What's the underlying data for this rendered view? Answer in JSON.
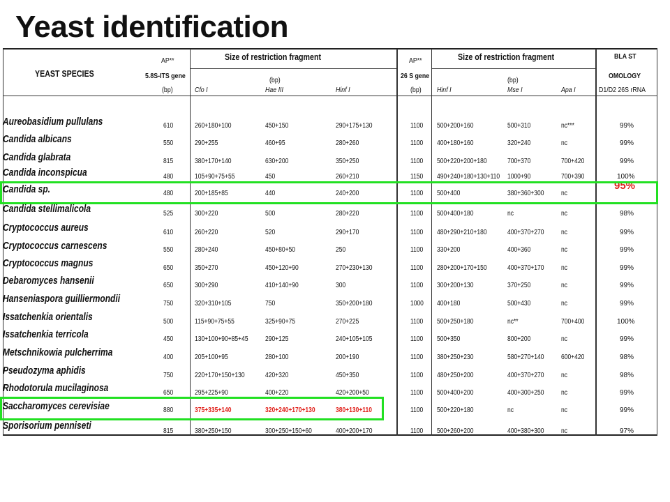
{
  "title": "Yeast identification",
  "header": {
    "species_label": "YEAST SPECIES",
    "ap1_label": "AP**",
    "ap1_gene": "5.8S-ITS gene",
    "ap1_unit": "(bp)",
    "frag1_label": "Size of restriction fragment",
    "frag1_unit": "(bp)",
    "enz1": [
      "Cfo I",
      "Hae III",
      "Hinf I"
    ],
    "ap2_label": "AP**",
    "ap2_gene": "26 S gene",
    "ap2_unit": "(bp)",
    "frag2_label": "Size of restriction fragment",
    "frag2_unit": "(bp)",
    "enz2": [
      "Hinf I",
      "Mse I",
      "Apa I"
    ],
    "blast_label": "BLA ST",
    "homology_label": "OMOLOGY",
    "homology_sub": "D1/D2 26S rRNA"
  },
  "rows": [
    {
      "species": "Aureobasidium pullulans",
      "ap1": "610",
      "cfo": "260+180+100",
      "hae": "450+150",
      "hinf1": "290+175+130",
      "ap2": "1100",
      "hinf2": "500+200+160",
      "mse": "500+310",
      "apa": "nc***",
      "hom": "99%"
    },
    {
      "species": "Candida albicans",
      "ap1": "550",
      "cfo": "290+255",
      "hae": "460+95",
      "hinf1": "280+260",
      "ap2": "1100",
      "hinf2": "400+180+160",
      "mse": "320+240",
      "apa": "nc",
      "hom": "99%"
    },
    {
      "species": "Candida glabrata",
      "ap1": "815",
      "cfo": "380+170+140",
      "hae": "630+200",
      "hinf1": "350+250",
      "ap2": "1100",
      "hinf2": "500+220+200+180",
      "mse": "700+370",
      "apa": "700+420",
      "hom": "99%"
    },
    {
      "species": "Candida inconspicua",
      "ap1": "480",
      "cfo": "105+90+75+55",
      "hae": "450",
      "hinf1": "260+210",
      "ap2": "1150",
      "hinf2": "490+240+180+130+110",
      "mse": "1000+90",
      "apa": "700+390",
      "hom": "100%"
    },
    {
      "species": "Candida sp.",
      "ap1": "480",
      "cfo": "200+185+85",
      "hae": "440",
      "hinf1": "240+200",
      "ap2": "1100",
      "hinf2": "500+400",
      "mse": "380+360+300",
      "apa": "nc",
      "hom": "95%"
    },
    {
      "species": "Candida stellimalicola",
      "ap1": "525",
      "cfo": "300+220",
      "hae": "500",
      "hinf1": "280+220",
      "ap2": "1100",
      "hinf2": "500+400+180",
      "mse": "nc",
      "apa": "nc",
      "hom": "98%"
    },
    {
      "species": "Cryptococcus aureus",
      "ap1": "610",
      "cfo": "260+220",
      "hae": "520",
      "hinf1": "290+170",
      "ap2": "1100",
      "hinf2": "480+290+210+180",
      "mse": "400+370+270",
      "apa": "nc",
      "hom": "99%"
    },
    {
      "species": "Cryptococcus carnescens",
      "ap1": "550",
      "cfo": "280+240",
      "hae": "450+80+50",
      "hinf1": "250",
      "ap2": "1100",
      "hinf2": "330+200",
      "mse": "400+360",
      "apa": "nc",
      "hom": "99%"
    },
    {
      "species": "Cryptococcus magnus",
      "ap1": "650",
      "cfo": "350+270",
      "hae": "450+120+90",
      "hinf1": "270+230+130",
      "ap2": "1100",
      "hinf2": "280+200+170+150",
      "mse": "400+370+170",
      "apa": "nc",
      "hom": "99%"
    },
    {
      "species": "Debaromyces hansenii",
      "ap1": "650",
      "cfo": "300+290",
      "hae": "410+140+90",
      "hinf1": "300",
      "ap2": "1100",
      "hinf2": "300+200+130",
      "mse": "370+250",
      "apa": "nc",
      "hom": "99%"
    },
    {
      "species": "Hanseniaspora guilliermondii",
      "ap1": "750",
      "cfo": "320+310+105",
      "hae": "750",
      "hinf1": "350+200+180",
      "ap2": "1000",
      "hinf2": "400+180",
      "mse": "500+430",
      "apa": "nc",
      "hom": "99%"
    },
    {
      "species": "Issatchenkia orientalis",
      "ap1": "500",
      "cfo": "115+90+75+55",
      "hae": "325+90+75",
      "hinf1": "270+225",
      "ap2": "1100",
      "hinf2": "500+250+180",
      "mse": "nc**",
      "apa": "700+400",
      "hom": "100%"
    },
    {
      "species": "Issatchenkia terricola",
      "ap1": "450",
      "cfo": "130+100+90+85+45",
      "hae": "290+125",
      "hinf1": "240+105+105",
      "ap2": "1100",
      "hinf2": "500+350",
      "mse": "800+200",
      "apa": "nc",
      "hom": "99%"
    },
    {
      "species": "Metschnikowia pulcherrima",
      "ap1": "400",
      "cfo": "205+100+95",
      "hae": "280+100",
      "hinf1": "200+190",
      "ap2": "1100",
      "hinf2": "380+250+230",
      "mse": "580+270+140",
      "apa": "600+420",
      "hom": "98%"
    },
    {
      "species": "Pseudozyma aphidis",
      "ap1": "750",
      "cfo": "220+170+150+130",
      "hae": "420+320",
      "hinf1": "450+350",
      "ap2": "1100",
      "hinf2": "480+250+200",
      "mse": "400+370+270",
      "apa": "nc",
      "hom": "98%"
    },
    {
      "species": "Rhodotorula mucilaginosa",
      "ap1": "650",
      "cfo": "295+225+90",
      "hae": "400+220",
      "hinf1": "420+200+50",
      "ap2": "1100",
      "hinf2": "500+400+200",
      "mse": "400+300+250",
      "apa": "nc",
      "hom": "99%"
    },
    {
      "species": "Saccharomyces cerevisiae",
      "ap1": "880",
      "cfo": "375+335+140",
      "hae": "320+240+170+130",
      "hinf1": "380+130+110",
      "ap2": "1100",
      "hinf2": "500+220+180",
      "mse": "nc",
      "apa": "nc",
      "hom": "99%"
    },
    {
      "species": "Sporisorium penniseti",
      "ap1": "815",
      "cfo": "380+250+150",
      "hae": "300+250+150+60",
      "hinf1": "400+200+170",
      "ap2": "1100",
      "hinf2": "500+260+200",
      "mse": "400+380+300",
      "apa": "nc",
      "hom": "97%"
    }
  ],
  "colors": {
    "highlight": "#22e022",
    "red_text": "#e0201a"
  }
}
